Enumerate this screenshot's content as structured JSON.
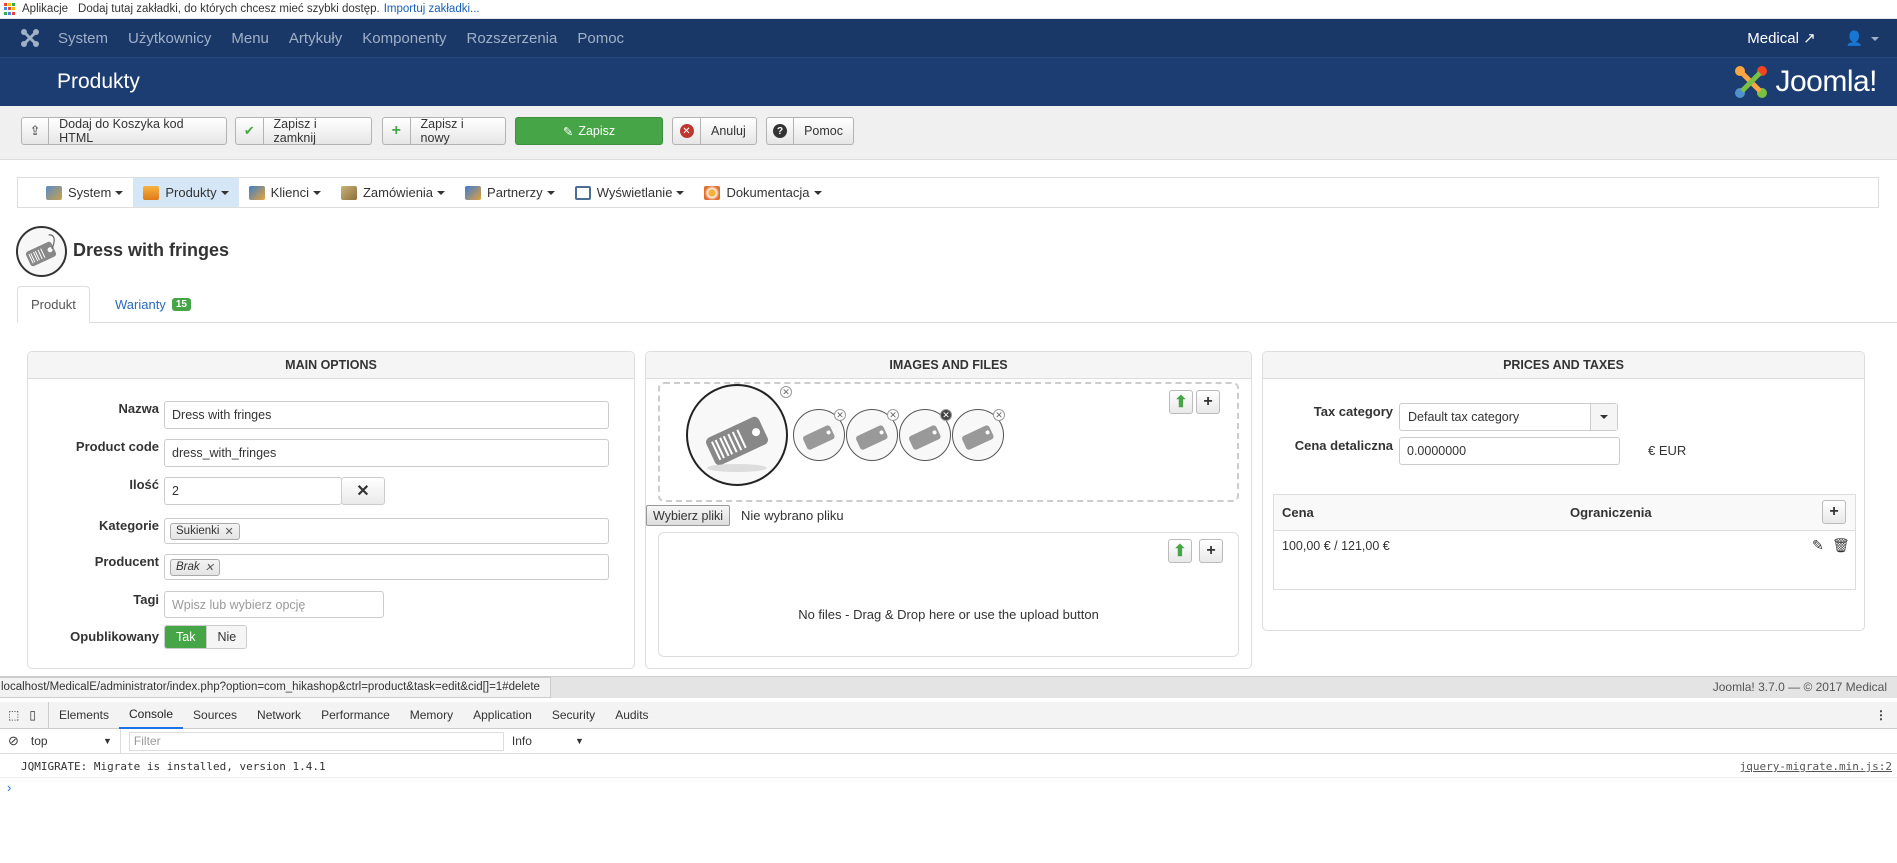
{
  "bookmarks": {
    "apps_label": "Aplikacje",
    "hint": "Dodaj tutaj zakładki, do których chcesz mieć szybki dostęp.",
    "import_link": "Importuj zakładki..."
  },
  "topnav": {
    "items": [
      "System",
      "Użytkownicy",
      "Menu",
      "Artykuły",
      "Komponenty",
      "Rozszerzenia",
      "Pomoc"
    ],
    "site_name": "Medical"
  },
  "header": {
    "title": "Produkty",
    "brand": "Joomla!"
  },
  "toolbar": {
    "add_to_cart": "Dodaj do Koszyka kod HTML",
    "save_close": "Zapisz i zamknij",
    "save_new": "Zapisz i nowy",
    "save": "Zapisz",
    "cancel": "Anuluj",
    "help": "Pomoc"
  },
  "hikamenu": {
    "items": [
      "System",
      "Produkty",
      "Klienci",
      "Zamówienia",
      "Partnerzy",
      "Wyświetlanie",
      "Dokumentacja"
    ]
  },
  "product": {
    "title": "Dress with fringes"
  },
  "tabs": {
    "product": "Produkt",
    "variants": "Warianty",
    "variants_count": "15"
  },
  "main_options": {
    "title": "MAIN OPTIONS",
    "name_label": "Nazwa",
    "name_value": "Dress with fringes",
    "code_label": "Product code",
    "code_value": "dress_with_fringes",
    "qty_label": "Ilość",
    "qty_value": "2",
    "categories_label": "Kategorie",
    "category_chip": "Sukienki",
    "manufacturer_label": "Producent",
    "manufacturer_chip": "Brak",
    "tags_label": "Tagi",
    "tags_placeholder": "Wpisz lub wybierz opcję",
    "published_label": "Opublikowany",
    "yes": "Tak",
    "no": "Nie"
  },
  "images": {
    "title": "IMAGES AND FILES",
    "choose_files": "Wybierz pliki",
    "no_file": "Nie wybrano pliku",
    "no_files_msg": "No files - Drag & Drop here or use the upload button"
  },
  "prices": {
    "title": "PRICES AND TAXES",
    "tax_label": "Tax category",
    "tax_value": "Default tax category",
    "retail_label": "Cena detaliczna",
    "retail_value": "0.0000000",
    "currency": "€ EUR",
    "col_price": "Cena",
    "col_restrictions": "Ograniczenia",
    "row_price": "100,00 € / 121,00 €"
  },
  "footer": {
    "url": "localhost/MedicalE/administrator/index.php?option=com_hikashop&ctrl=product&task=edit&cid[]=1#delete",
    "copyright": "Joomla! 3.7.0  —  © 2017 Medical"
  },
  "devtools": {
    "tabs": [
      "Elements",
      "Console",
      "Sources",
      "Network",
      "Performance",
      "Memory",
      "Application",
      "Security",
      "Audits"
    ],
    "context": "top",
    "filter_placeholder": "Filter",
    "level": "Info",
    "message": "JQMIGRATE: Migrate is installed, version 1.4.1",
    "source": "jquery-migrate.min.js:2",
    "prompt": "›"
  },
  "colors": {
    "nav_bg": "#1a3867",
    "header_bg": "#1c3d72",
    "success": "#46a546",
    "link": "#2a69b8"
  }
}
